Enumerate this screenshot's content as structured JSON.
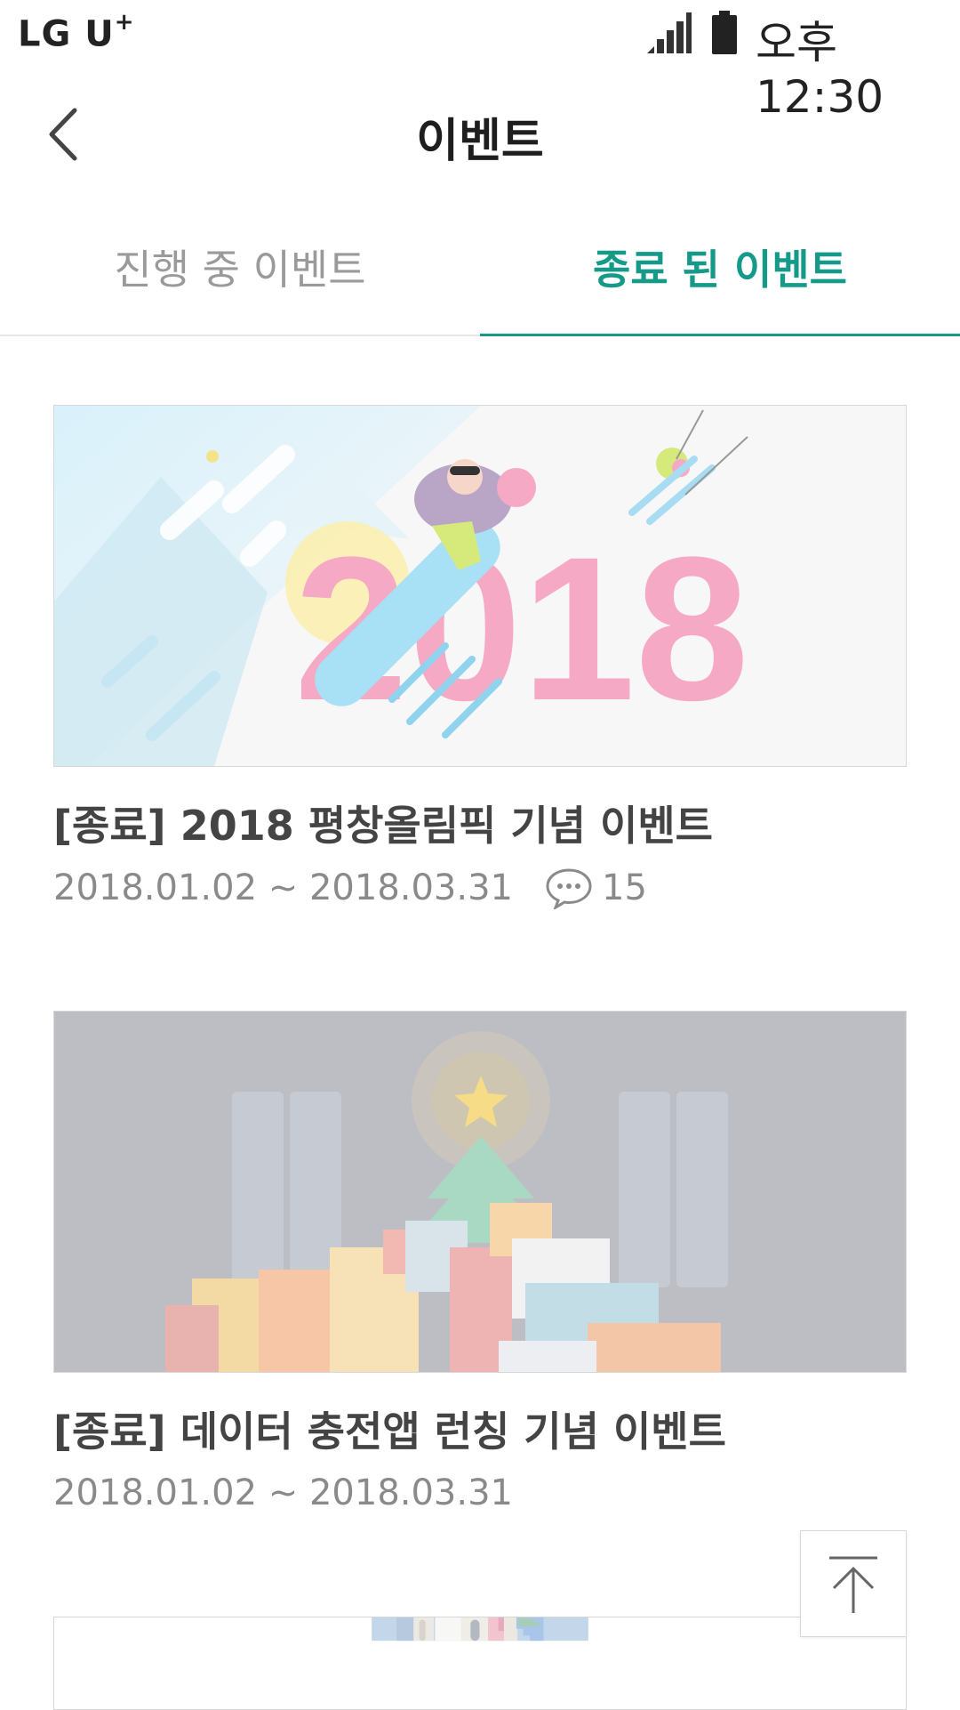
{
  "status_bar": {
    "carrier": "LG U",
    "carrier_plus": "+",
    "time": "오후 12:30"
  },
  "header": {
    "title": "이벤트"
  },
  "tabs": [
    {
      "label": "진행 중 이벤트",
      "active": false
    },
    {
      "label": "종료 된 이벤트",
      "active": true
    }
  ],
  "accent_color": "#159a8a",
  "events": [
    {
      "title": "[종료] 2018 평창올림픽 기념 이벤트",
      "period": "2018.01.02 ~ 2018.03.31",
      "comment_count": "15",
      "banner_text": "2018"
    },
    {
      "title": "[종료] 데이터 충전앱 런칭 기념 이벤트",
      "period": "2018.01.02 ~ 2018.03.31"
    }
  ],
  "icons": {
    "back": "chevron-left-icon",
    "comment": "speech-bubble-icon",
    "scroll_top": "arrow-up-to-top-icon"
  }
}
